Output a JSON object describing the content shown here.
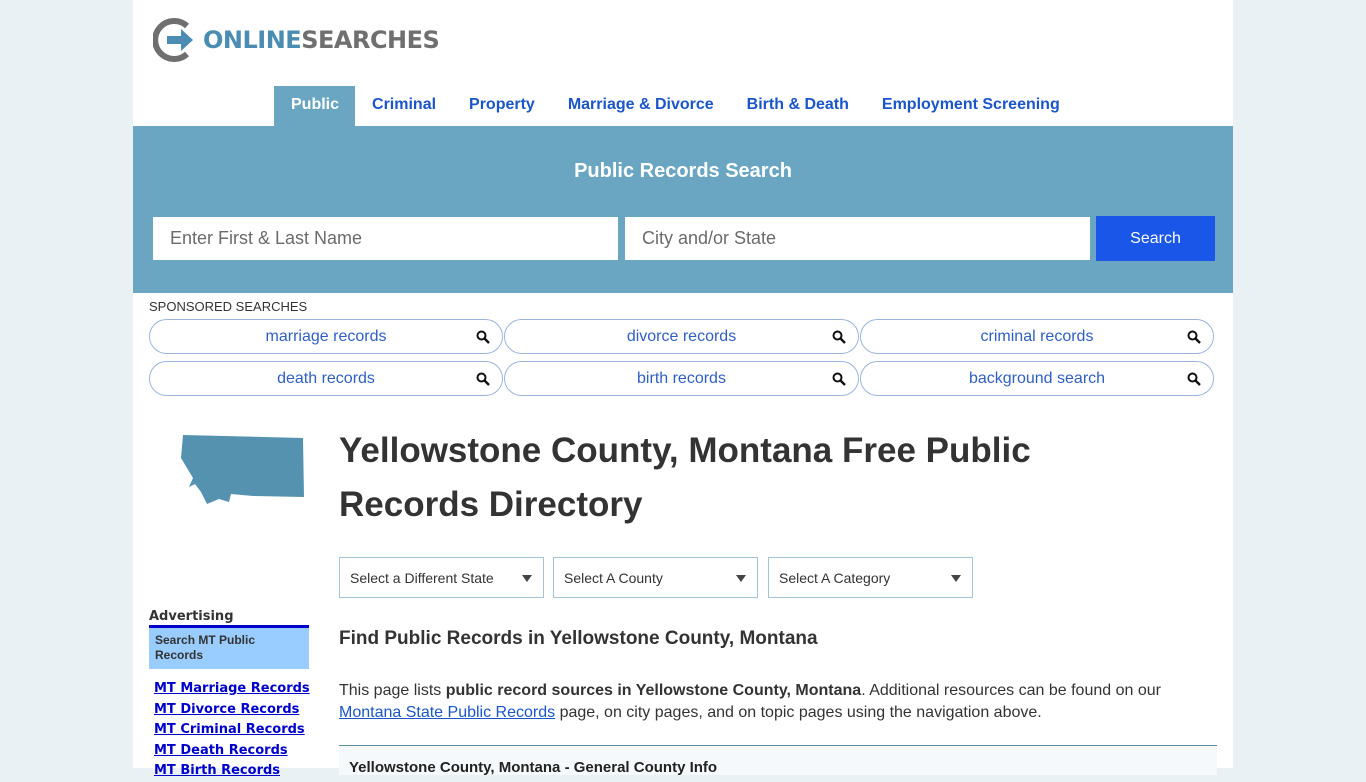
{
  "logo": {
    "online": "ONLINE",
    "searches": "SEARCHES"
  },
  "nav": {
    "items": [
      {
        "label": "Public",
        "active": true
      },
      {
        "label": "Criminal"
      },
      {
        "label": "Property"
      },
      {
        "label": "Marriage & Divorce"
      },
      {
        "label": "Birth & Death"
      },
      {
        "label": "Employment Screening"
      }
    ]
  },
  "hero": {
    "title": "Public Records Search",
    "name_placeholder": "Enter First & Last Name",
    "location_placeholder": "City and/or State",
    "search_label": "Search"
  },
  "sponsored": {
    "label": "SPONSORED SEARCHES",
    "items": [
      "marriage records",
      "divorce records",
      "criminal records",
      "death records",
      "birth records",
      "background search"
    ]
  },
  "main": {
    "title": "Yellowstone County, Montana Free Public Records Directory",
    "selects": [
      "Select a Different State",
      "Select A County",
      "Select A Category"
    ],
    "subtitle": "Find Public Records in Yellowstone County, Montana",
    "intro_pre": "This page lists ",
    "intro_bold": "public record sources in Yellowstone County, Montana",
    "intro_mid": ". Additional resources can be found on our ",
    "intro_link": "Montana State Public Records",
    "intro_post": " page, on city pages, and on topic pages using the navigation above.",
    "info_box_title": "Yellowstone County, Montana - General County Info"
  },
  "sidebar": {
    "advertising_label": "Advertising",
    "ad_box": "Search MT Public Records",
    "links": [
      "MT Marriage Records",
      "MT Divorce Records",
      "MT Criminal Records",
      "MT Death Records",
      "MT Birth Records"
    ]
  },
  "colors": {
    "brand_blue": "#4b8db2",
    "hero_bg": "#6aa6c1",
    "search_button": "#1a56e8",
    "nav_link": "#1a56c9"
  }
}
